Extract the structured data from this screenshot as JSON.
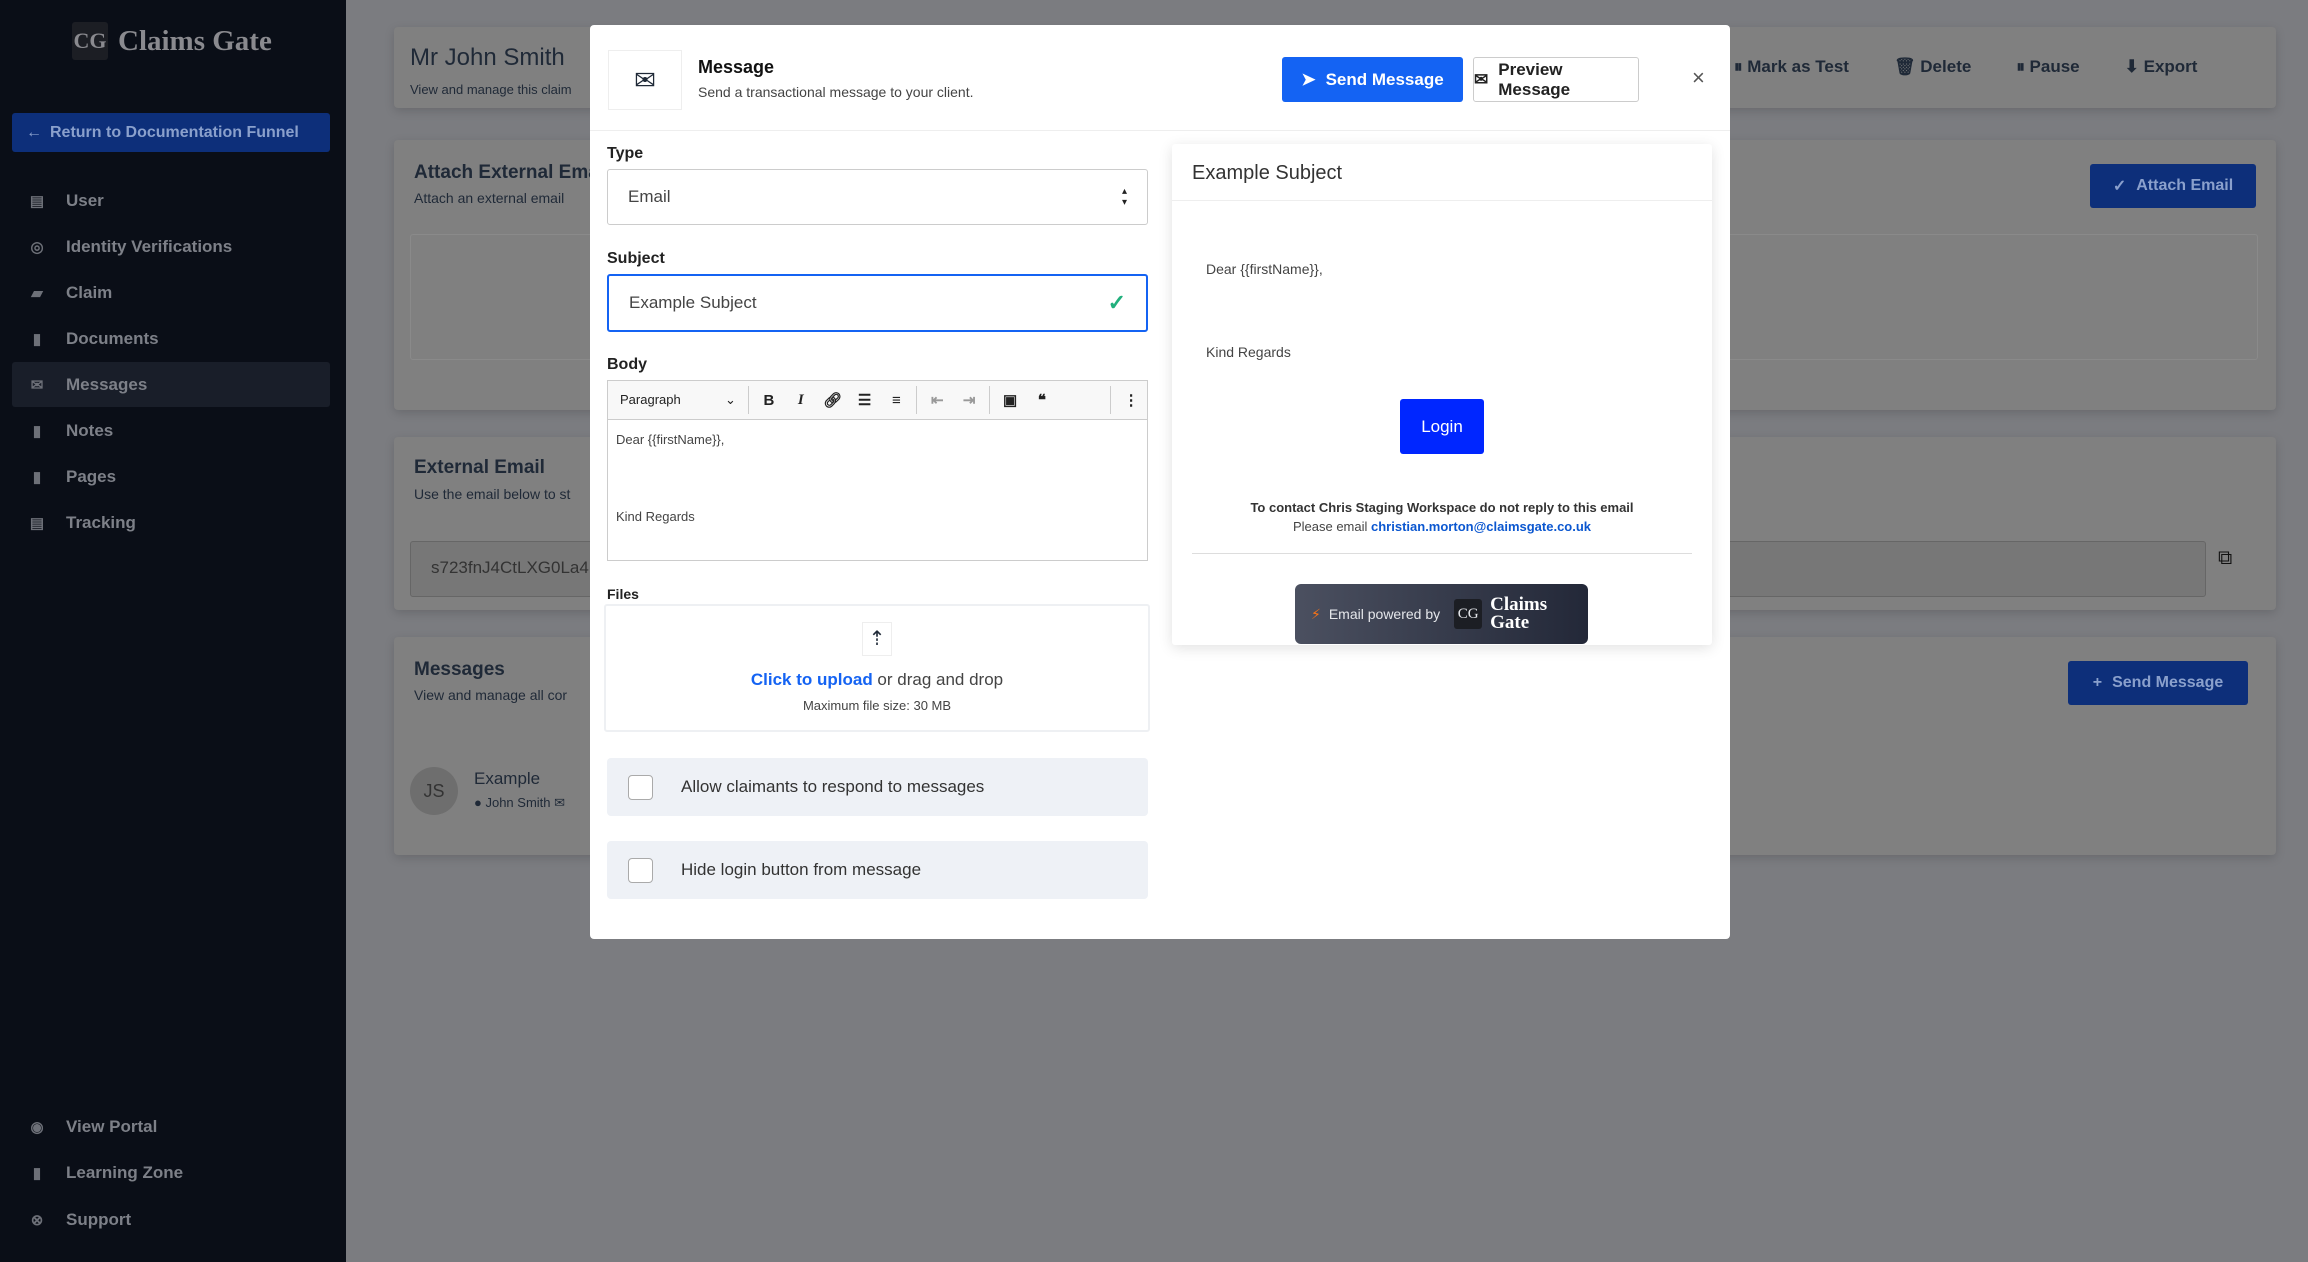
{
  "sidebar": {
    "brand": "Claims Gate",
    "logo_mark": "CG",
    "return_button": "Return to Documentation Funnel",
    "items": [
      {
        "label": "User",
        "icon": "id-card-icon"
      },
      {
        "label": "Identity Verifications",
        "icon": "fingerprint-icon"
      },
      {
        "label": "Claim",
        "icon": "folder-open-icon"
      },
      {
        "label": "Documents",
        "icon": "file-text-icon"
      },
      {
        "label": "Messages",
        "icon": "envelope-icon",
        "active": true
      },
      {
        "label": "Notes",
        "icon": "clipboard-icon"
      },
      {
        "label": "Pages",
        "icon": "file-icon"
      },
      {
        "label": "Tracking",
        "icon": "receipt-icon"
      }
    ],
    "footer_items": [
      {
        "label": "View Portal",
        "icon": "globe-icon"
      },
      {
        "label": "Learning Zone",
        "icon": "book-icon"
      },
      {
        "label": "Support",
        "icon": "life-ring-icon"
      }
    ]
  },
  "background": {
    "claim_title": "Mr John Smith",
    "claim_subtitle": "View and manage this claim",
    "actions": [
      "Mark as Test",
      "Delete",
      "Pause",
      "Export"
    ],
    "attach_title": "Attach External Email",
    "attach_sub": "Attach an external email",
    "attach_button": "Attach Email",
    "external_title": "External Email",
    "external_sub": "Use the email below to st",
    "external_value": "s723fnJ4CtLXG0La4",
    "messages_title": "Messages",
    "messages_sub": "View and manage all cor",
    "send_button": "Send Message",
    "message_item": {
      "initials": "JS",
      "title": "Example",
      "author": "John Smith"
    }
  },
  "modal": {
    "title": "Message",
    "subtitle": "Send a transactional message to your client.",
    "send_button": "Send Message",
    "preview_button": "Preview Message",
    "close": "×",
    "type_label": "Type",
    "type_value": "Email",
    "subject_label": "Subject",
    "subject_value": "Example Subject",
    "body_label": "Body",
    "toolbar": {
      "paragraph": "Paragraph"
    },
    "body_line1": "Dear {{firstName}},",
    "body_line2": "Kind Regards",
    "files_label": "Files",
    "upload_link": "Click to upload",
    "upload_rest": " or drag and drop",
    "upload_limit": "Maximum file size: 30 MB",
    "checkbox1": "Allow claimants to respond to messages",
    "checkbox2": "Hide login button from message"
  },
  "preview": {
    "subject": "Example Subject",
    "line1": "Dear {{firstName}},",
    "line2": "Kind Regards",
    "login": "Login",
    "contact": "To contact Chris Staging Workspace do not reply to this email",
    "please": "Please email ",
    "email": "christian.morton@claimsgate.co.uk",
    "powered": "Email powered by",
    "brand_line1": "Claims",
    "brand_line2": "Gate"
  },
  "colors": {
    "primary": "#1463f3",
    "login": "#0026ff",
    "sidebar": "#0a0e17",
    "link": "#0b57d0"
  }
}
